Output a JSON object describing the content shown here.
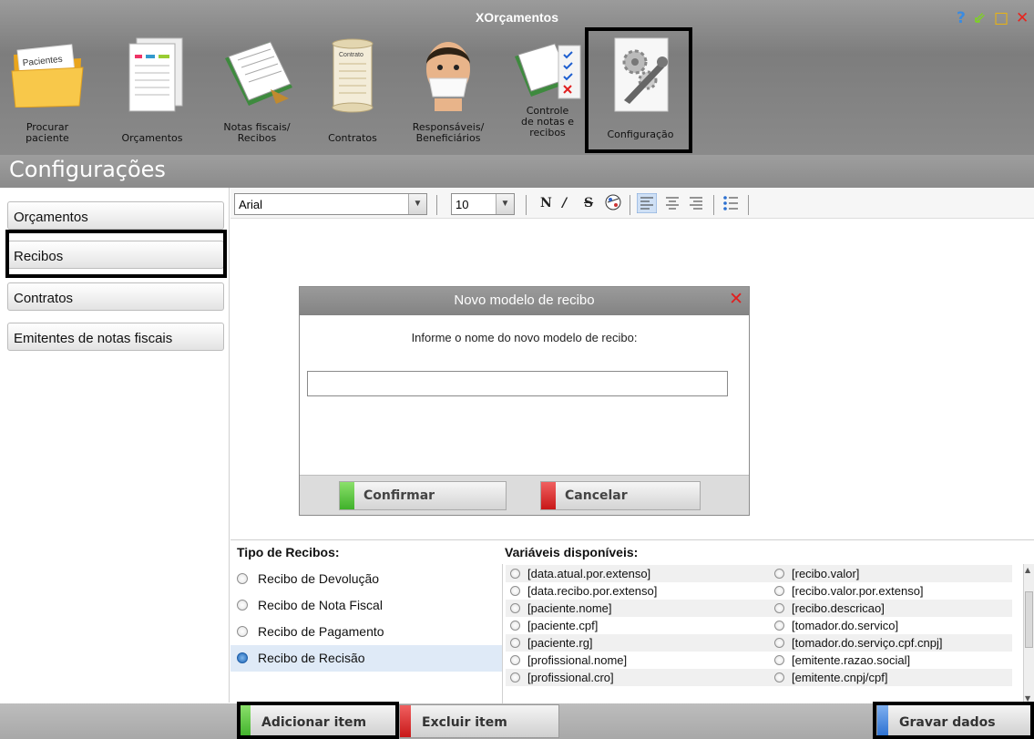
{
  "app": {
    "title": "XOrçamentos"
  },
  "window_controls": {
    "help": "?",
    "minimize": "⇙",
    "maximize": "□",
    "close": "✕"
  },
  "toolbar_main": {
    "items": [
      {
        "label": "Procurar paciente",
        "icon": "folder-patients-icon",
        "icon_text": "Pacientes"
      },
      {
        "label": "Orçamentos",
        "icon": "budget-document-icon"
      },
      {
        "label": "Notas fiscais/ Recibos",
        "icon": "invoice-pad-icon"
      },
      {
        "label": "Contratos",
        "icon": "contract-scroll-icon",
        "icon_text": "Contrato"
      },
      {
        "label": "Responsáveis/ Beneficiários",
        "icon": "person-masked-icon"
      },
      {
        "label": "Controle de notas e recibos",
        "icon": "checklist-icon"
      },
      {
        "label": "Configuração",
        "icon": "gear-wrench-icon"
      }
    ],
    "selected": "Configuração"
  },
  "section": {
    "title": "Configurações"
  },
  "sidebar": {
    "items": [
      {
        "label": "Orçamentos"
      },
      {
        "label": "Recibos"
      },
      {
        "label": "Contratos"
      },
      {
        "label": "Emitentes de notas fiscais"
      }
    ],
    "selected": "Recibos"
  },
  "editor_toolbar": {
    "font": "Arial",
    "size": "10",
    "bold": "N",
    "italic": "/",
    "strike": "S",
    "color_icon": "paint-icon"
  },
  "dialog": {
    "title": "Novo modelo de recibo",
    "prompt": "Informe o nome do novo modelo de recibo:",
    "input_value": "",
    "confirm": "Confirmar",
    "cancel": "Cancelar"
  },
  "tipos": {
    "header": "Tipo de Recibos:",
    "items": [
      {
        "label": "Recibo de Devolução",
        "selected": false
      },
      {
        "label": "Recibo de Nota Fiscal",
        "selected": false
      },
      {
        "label": "Recibo de Pagamento",
        "selected": false
      },
      {
        "label": "Recibo de Recisão",
        "selected": true
      }
    ]
  },
  "variaveis": {
    "header": "Variáveis disponíveis:",
    "left": [
      "[data.atual.por.extenso]",
      "[data.recibo.por.extenso]",
      "[paciente.nome]",
      "[paciente.cpf]",
      "[paciente.rg]",
      "[profissional.nome]",
      "[profissional.cro]"
    ],
    "right": [
      "[recibo.valor]",
      "[recibo.valor.por.extenso]",
      "[recibo.descricao]",
      "[tomador.do.servico]",
      "[tomador.do.serviço.cpf.cnpj]",
      "[emitente.razao.social]",
      "[emitente.cnpj/cpf]"
    ]
  },
  "footer": {
    "add": "Adicionar item",
    "remove": "Excluir item",
    "save": "Gravar dados"
  },
  "colors": {
    "green": "#3fb12a",
    "red": "#d42020",
    "blue": "#2a6fd0",
    "selected_row": "#dfeaf7"
  }
}
